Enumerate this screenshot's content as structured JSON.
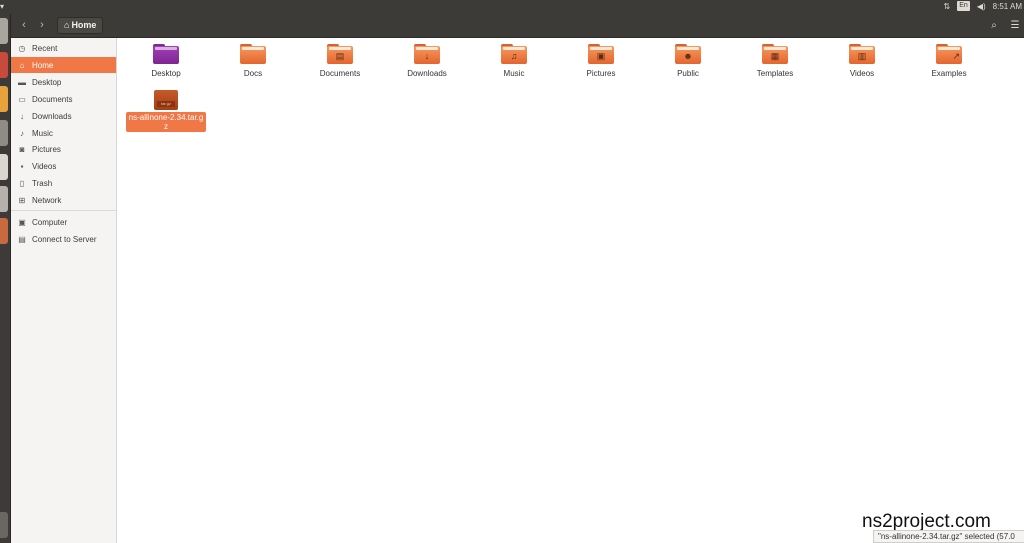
{
  "topbar": {
    "network_icon": "network-arrows-icon",
    "keyboard_layout": "En",
    "volume_icon": "volume-icon",
    "clock": "8:51 AM",
    "power_icon": "power-icon"
  },
  "toolbar": {
    "back_icon": "back-icon",
    "forward_icon": "forward-icon",
    "path_home_icon": "home-icon",
    "path_label": "Home",
    "search_icon": "search-icon",
    "menu_icon": "menu-icon"
  },
  "sidebar": {
    "items": [
      {
        "label": "Recent",
        "icon": "clock-icon"
      },
      {
        "label": "Home",
        "icon": "home-icon"
      },
      {
        "label": "Desktop",
        "icon": "desktop-icon"
      },
      {
        "label": "Documents",
        "icon": "documents-icon"
      },
      {
        "label": "Downloads",
        "icon": "download-icon"
      },
      {
        "label": "Music",
        "icon": "music-icon"
      },
      {
        "label": "Pictures",
        "icon": "camera-icon"
      },
      {
        "label": "Videos",
        "icon": "video-icon"
      },
      {
        "label": "Trash",
        "icon": "trash-icon"
      },
      {
        "label": "Network",
        "icon": "network-icon"
      },
      {
        "label": "Computer",
        "icon": "computer-icon"
      },
      {
        "label": "Connect to Server",
        "icon": "server-icon"
      }
    ]
  },
  "files": [
    {
      "label": "Desktop"
    },
    {
      "label": "Docs"
    },
    {
      "label": "Documents"
    },
    {
      "label": "Downloads"
    },
    {
      "label": "Music"
    },
    {
      "label": "Pictures"
    },
    {
      "label": "Public"
    },
    {
      "label": "Templates"
    },
    {
      "label": "Videos"
    },
    {
      "label": "Examples"
    }
  ],
  "archive": {
    "label": "ns-allinone-2.34.tar.gz",
    "tag": "tar.gz"
  },
  "watermark": "ns2project.com",
  "status": "\"ns-allinone-2.34.tar.gz\" selected (57.0",
  "colors": {
    "accent": "#f07746",
    "folder": "#e9763e",
    "toolbar": "#3c3b37"
  }
}
